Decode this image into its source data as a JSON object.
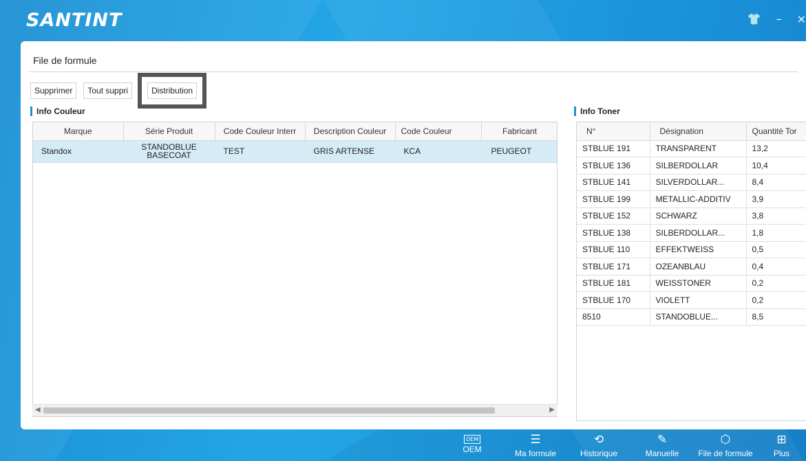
{
  "app": {
    "logo": "SANTINT",
    "window_controls": [
      "shirt-icon",
      "minimize-icon",
      "close-icon"
    ]
  },
  "panel": {
    "title": "File de formule",
    "buttons": {
      "delete": "Supprimer",
      "delete_all": "Tout suppri",
      "distribution": "Distribution"
    }
  },
  "info_couleur": {
    "label": "Info Couleur",
    "columns": [
      "Marque",
      "Série Produit",
      "Code Couleur Interr",
      "Description Couleur",
      "Code Couleur",
      "Fabricant"
    ],
    "rows": [
      {
        "marque": "Standox",
        "serie_line1": "STANDOBLUE",
        "serie_line2": "BASECOAT",
        "code_interne": "TEST",
        "description": "GRIS ARTENSE",
        "code": "KCA",
        "fabricant": "PEUGEOT"
      }
    ]
  },
  "info_toner": {
    "label": "Info Toner",
    "columns": [
      "N°",
      "Désignation",
      "Quantité Tor"
    ],
    "rows": [
      {
        "n": "STBLUE 191",
        "designation": "TRANSPARENT",
        "quantite": "13,2"
      },
      {
        "n": "STBLUE 136",
        "designation": "SILBERDOLLAR",
        "quantite": "10,4"
      },
      {
        "n": "STBLUE 141",
        "designation": "SILVERDOLLAR...",
        "quantite": "8,4"
      },
      {
        "n": "STBLUE 199",
        "designation": "METALLIC-ADDITIV",
        "quantite": "3,9"
      },
      {
        "n": "STBLUE 152",
        "designation": "SCHWARZ",
        "quantite": "3,8"
      },
      {
        "n": "STBLUE 138",
        "designation": "SILBERDOLLAR...",
        "quantite": "1,8"
      },
      {
        "n": "STBLUE 110",
        "designation": "EFFEKTWEISS",
        "quantite": "0,5"
      },
      {
        "n": "STBLUE 171",
        "designation": "OZEANBLAU",
        "quantite": "0,4"
      },
      {
        "n": "STBLUE 181",
        "designation": "WEISSTONER",
        "quantite": "0,2"
      },
      {
        "n": "STBLUE 170",
        "designation": "VIOLETT",
        "quantite": "0,2"
      },
      {
        "n": "8510",
        "designation": "STANDOBLUE...",
        "quantite": "8,5"
      }
    ]
  },
  "taskbar": {
    "items": [
      {
        "label": "OEM",
        "icon": "oem-icon"
      },
      {
        "label": "Ma formule",
        "icon": "list-icon"
      },
      {
        "label": "Historique",
        "icon": "history-icon"
      },
      {
        "label": "Manuelle",
        "icon": "pen-icon"
      },
      {
        "label": "File de formule",
        "icon": "cube-icon"
      },
      {
        "label": "Plus",
        "icon": "grid-icon"
      }
    ]
  },
  "colors": {
    "brand_blue": "#1a8fd4",
    "selected_row": "#d5ebf6"
  }
}
